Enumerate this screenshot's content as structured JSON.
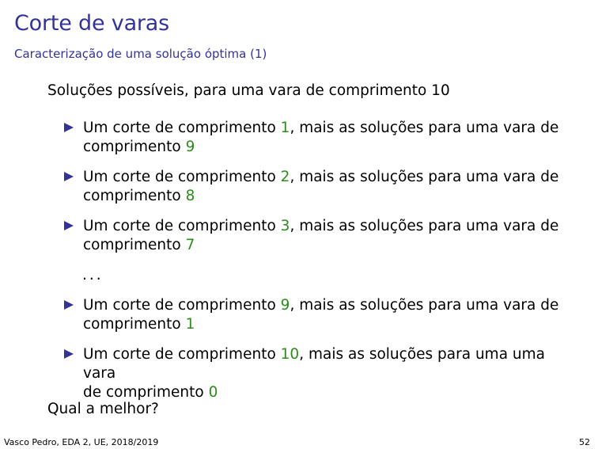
{
  "title": "Corte de varas",
  "subtitle": "Caracterização de uma solução óptima (1)",
  "intro": "Soluções possíveis, para uma vara de comprimento 10",
  "items": [
    {
      "prefix": "Um corte de comprimento ",
      "n1": "1",
      "middle": ", mais as soluções para uma vara de",
      "line2": "comprimento ",
      "n2": "9"
    },
    {
      "prefix": "Um corte de comprimento ",
      "n1": "2",
      "middle": ", mais as soluções para uma vara de",
      "line2": "comprimento ",
      "n2": "8"
    },
    {
      "prefix": "Um corte de comprimento ",
      "n1": "3",
      "middle": ", mais as soluções para uma vara de",
      "line2": "comprimento ",
      "n2": "7"
    },
    {
      "prefix": "Um corte de comprimento ",
      "n1": "9",
      "middle": ", mais as soluções para uma vara de",
      "line2": "comprimento ",
      "n2": "1"
    },
    {
      "prefix": "Um corte de comprimento ",
      "n1": "10",
      "middle": ", mais as soluções para uma uma vara",
      "line2": "de comprimento ",
      "n2": "0"
    }
  ],
  "ellipsis": "...",
  "question": "Qual a melhor?",
  "footer": {
    "left": "Vasco Pedro, EDA 2, UE, 2018/2019",
    "page": "52"
  },
  "colors": {
    "title": "#333399",
    "number_highlight": "#2e8b1e",
    "bullet": "#333399"
  }
}
